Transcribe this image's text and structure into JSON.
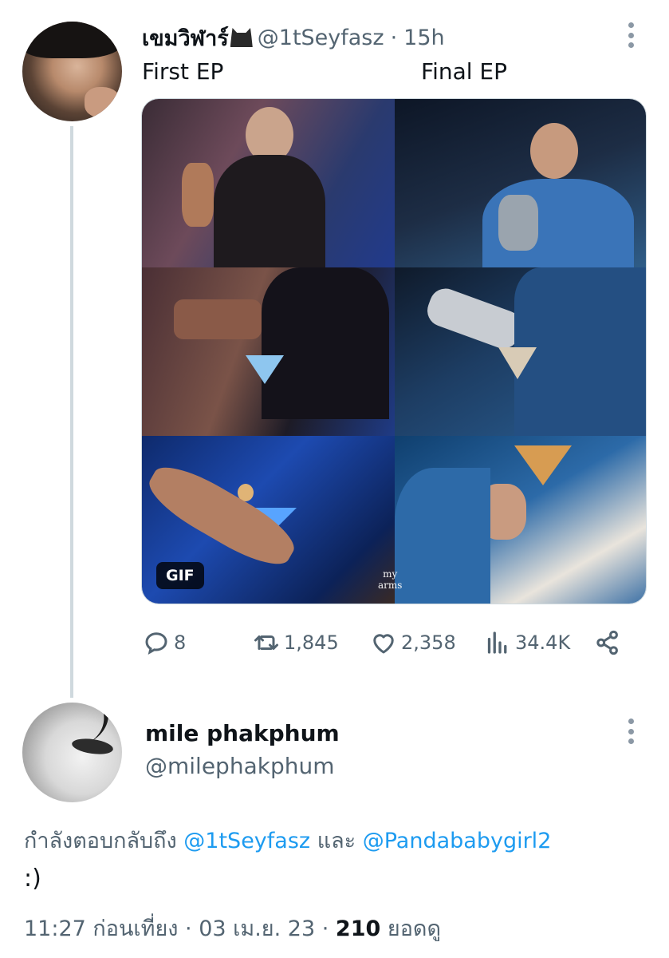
{
  "tweet": {
    "author_name": "เขมวิฬาร์",
    "author_emoji_icon": "black-cat-icon",
    "handle": "@1tSeyfasz",
    "separator": "·",
    "time": "15h",
    "caption_left": "First EP",
    "caption_right": "Final EP",
    "media": {
      "badge": "GIF",
      "watermark_line1": "my",
      "watermark_line2": "arms"
    },
    "stats": {
      "replies": "8",
      "retweets": "1,845",
      "likes": "2,358",
      "views": "34.4K"
    }
  },
  "reply": {
    "author_name": "mile phakphum",
    "handle": "@milephakphum",
    "replying_prefix": "กำลังตอบกลับถึง",
    "mention_1": "@1tSeyfasz",
    "conjunction": "และ",
    "mention_2": "@Pandababygirl2",
    "text": ":)",
    "time": "11:27 ก่อนเที่ยง",
    "dot1": "·",
    "date": "03 เม.ย. 23",
    "dot2": "·",
    "views_count": "210",
    "views_label": "ยอดดู"
  },
  "colors": {
    "link": "#1d9bf0",
    "secondary_text": "#536471",
    "thread_line": "#cfd9de"
  }
}
